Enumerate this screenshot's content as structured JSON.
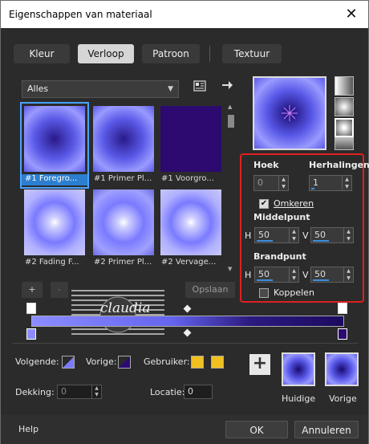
{
  "window": {
    "title": "Eigenschappen van materiaal",
    "close_glyph": "✕"
  },
  "tabs": [
    "Kleur",
    "Verloop",
    "Patroon",
    "Textuur"
  ],
  "active_tab": "Verloop",
  "filter": {
    "selected": "Alles"
  },
  "toolbar_icons": [
    "library-icon",
    "arrow-right-icon"
  ],
  "gradients": [
    {
      "caption": "#1 Foregro...",
      "selected": true
    },
    {
      "caption": "#1 Primer Pl...",
      "selected": false
    },
    {
      "caption": "#1 Voorgro...",
      "selected": false
    },
    {
      "caption": "#2 Fading F...",
      "selected": false
    },
    {
      "caption": "#2 Primer Pl...",
      "selected": false
    },
    {
      "caption": "#2 Vervage...",
      "selected": false
    }
  ],
  "actions": {
    "add": "+",
    "remove": "-",
    "save": "Opslaan"
  },
  "panel": {
    "angle_label": "Hoek",
    "angle_value": "0",
    "repeats_label": "Herhalingen",
    "repeats_value": "1",
    "invert_label": "Omkeren",
    "invert_checked": true,
    "center_label": "Middelpunt",
    "center_h_label": "H",
    "center_h": "50",
    "center_v_label": "V",
    "center_v": "50",
    "focus_label": "Brandpunt",
    "focus_h_label": "H",
    "focus_h": "50",
    "focus_v_label": "V",
    "focus_v": "50",
    "link_label": "Koppelen",
    "link_checked": false
  },
  "stops": {
    "next_label": "Volgende:",
    "prev_label": "Vorige:",
    "user_label": "Gebruiker:",
    "opacity_label": "Dekking:",
    "opacity_value": "0",
    "location_label": "Locatie:",
    "location_value": "0"
  },
  "preview": {
    "current_label": "Huidige",
    "previous_label": "Vorige"
  },
  "watermark": {
    "text": "claudia"
  },
  "buttons": {
    "help": "Help",
    "ok": "OK",
    "cancel": "Annuleren"
  },
  "colors": {
    "accent": "#2c7fd0",
    "highlight_border": "#e02020",
    "gradient_light": "#8c8cff",
    "gradient_dark": "#2c0a70",
    "user_color": "#f0c020"
  }
}
